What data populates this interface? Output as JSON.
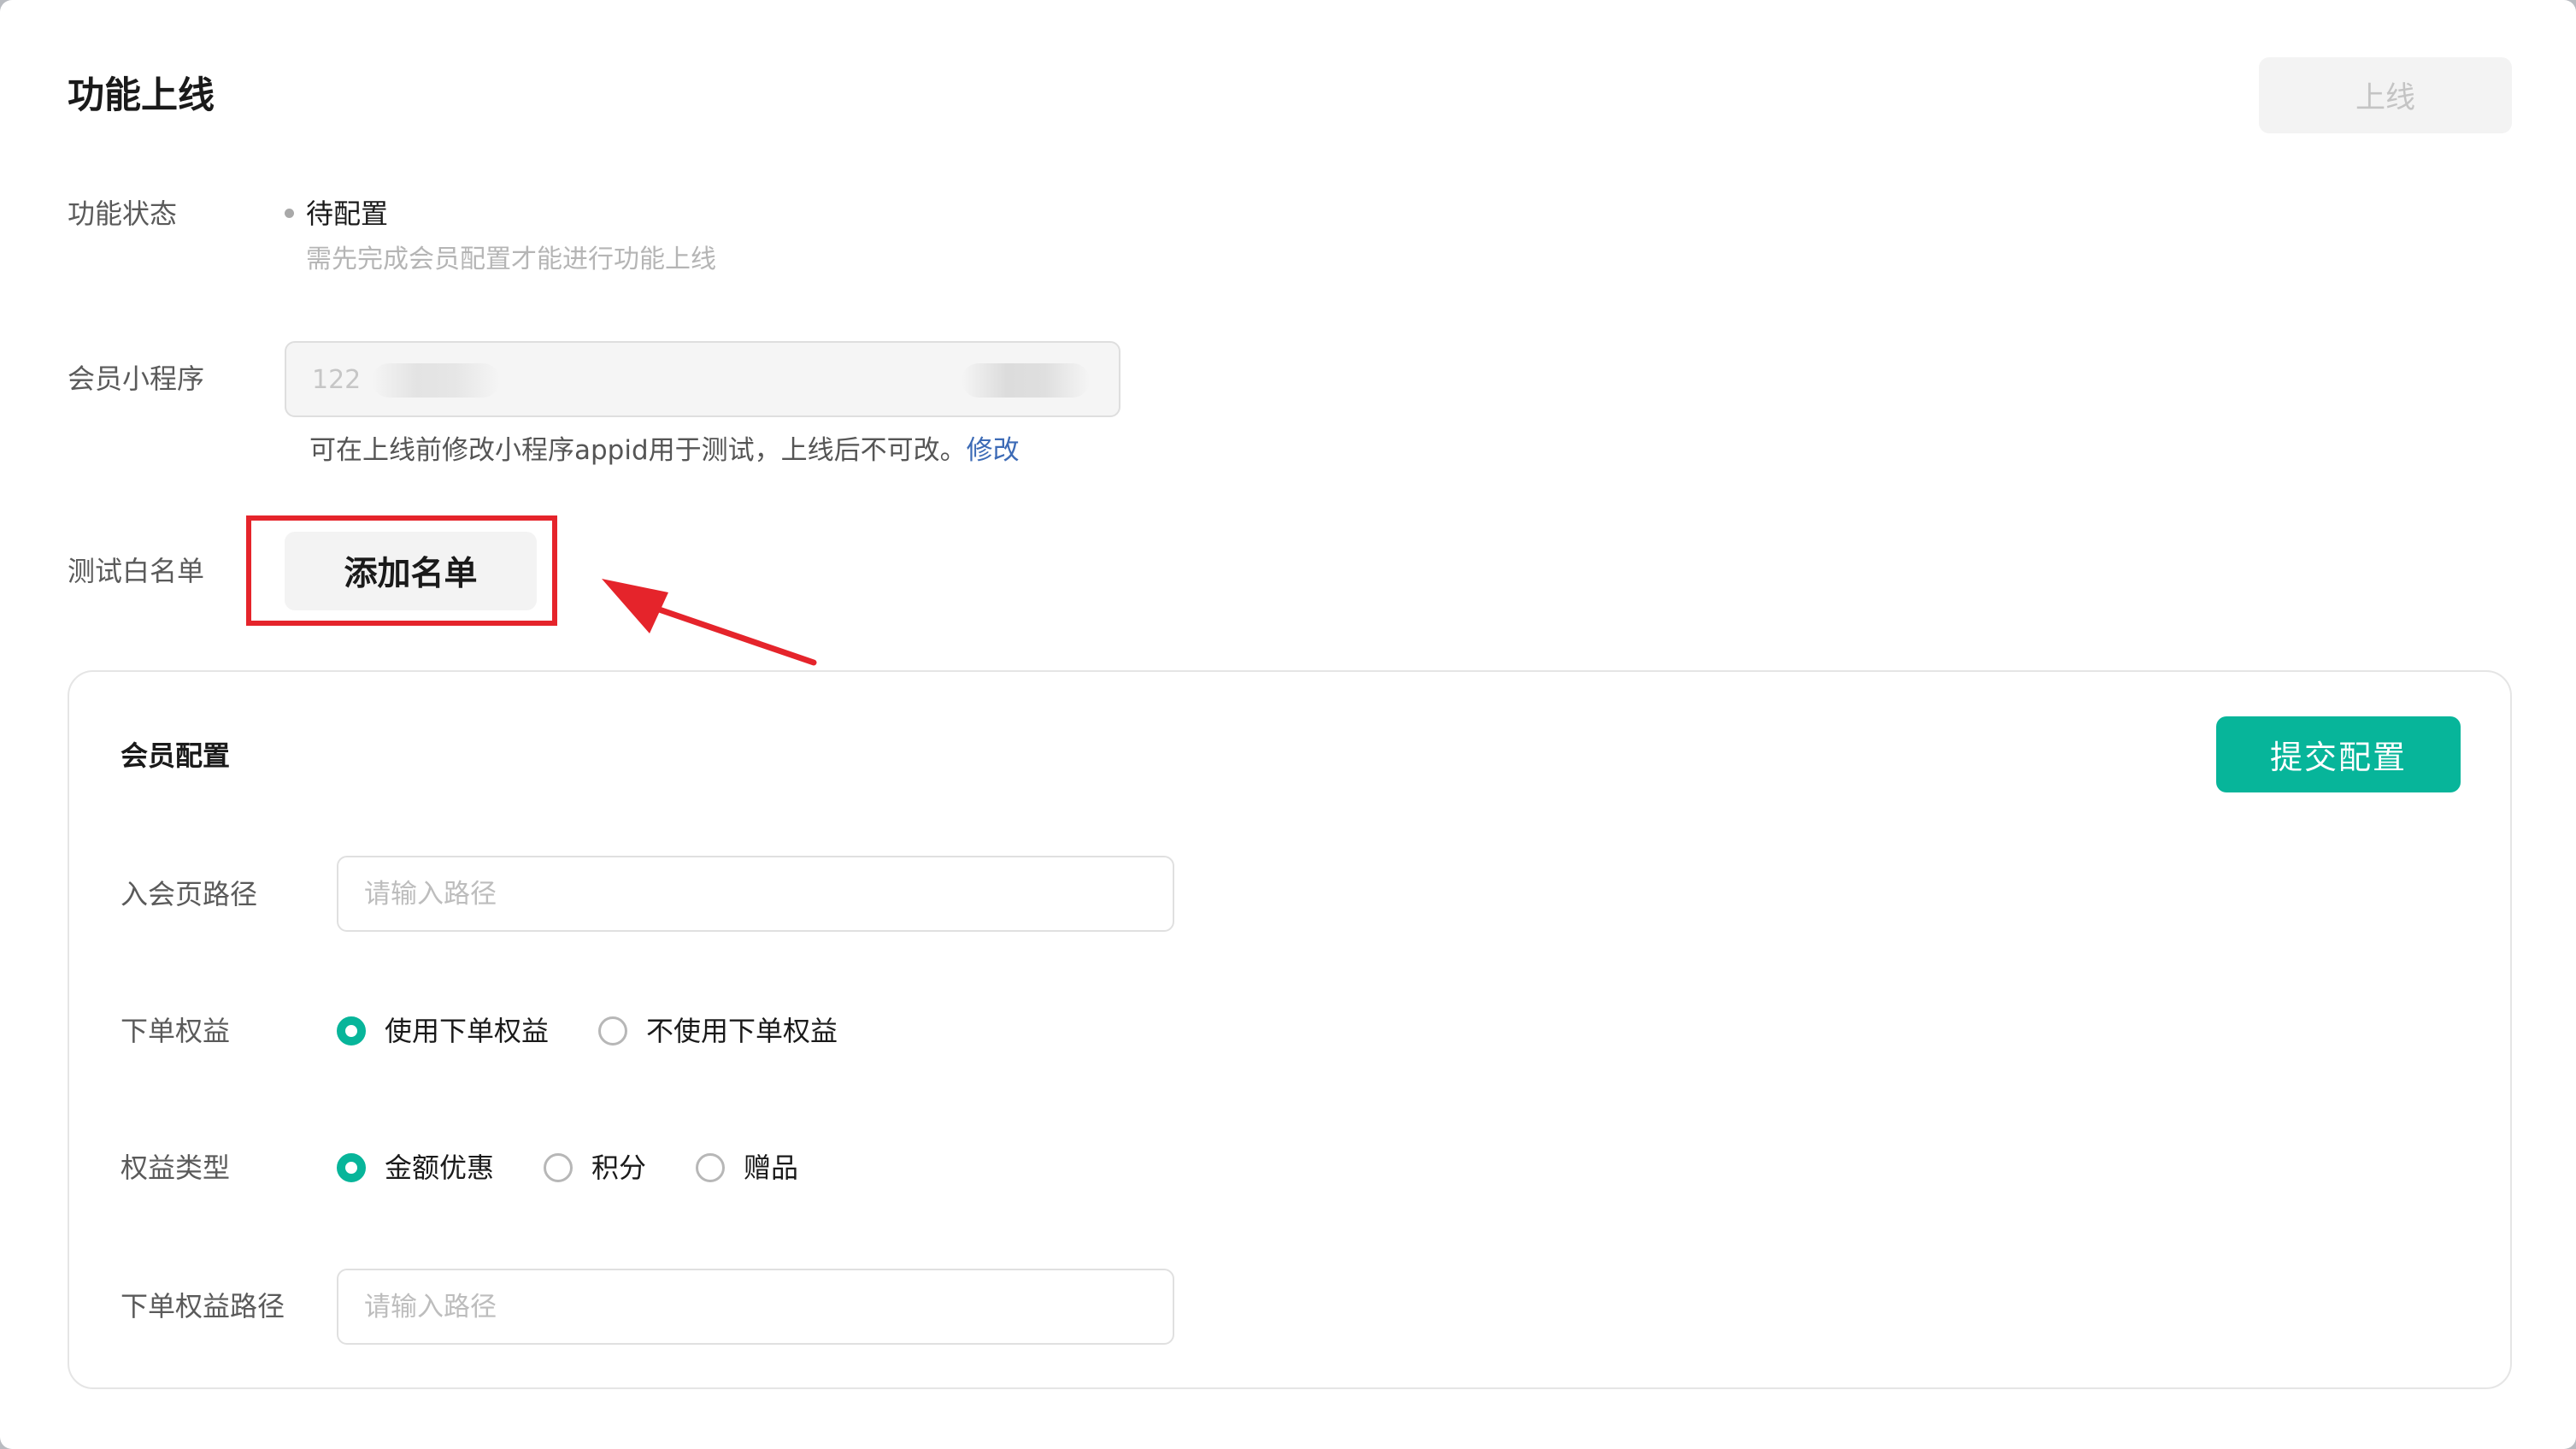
{
  "header": {
    "title": "功能上线",
    "online_button": "上线"
  },
  "status": {
    "label": "功能状态",
    "value": "待配置",
    "hint": "需先完成会员配置才能进行功能上线"
  },
  "mini_program": {
    "label": "会员小程序",
    "appid_value": "122",
    "hint": "可在上线前修改小程序appid用于测试，上线后不可改。",
    "modify_link": "修改"
  },
  "whitelist": {
    "label": "测试白名单",
    "add_button": "添加名单"
  },
  "member_config": {
    "title": "会员配置",
    "submit_button": "提交配置",
    "join_path": {
      "label": "入会页路径",
      "placeholder": "请输入路径",
      "value": ""
    },
    "order_benefit": {
      "label": "下单权益",
      "options": [
        "使用下单权益",
        "不使用下单权益"
      ],
      "selected": "使用下单权益"
    },
    "benefit_type": {
      "label": "权益类型",
      "options": [
        "金额优惠",
        "积分",
        "赠品"
      ],
      "selected": "金额优惠"
    },
    "order_benefit_path": {
      "label": "下单权益路径",
      "placeholder": "请输入路径",
      "value": ""
    }
  },
  "colors": {
    "primary": "#07b59a",
    "link": "#3d6bb6",
    "highlight": "#e5242b"
  },
  "icons": {
    "status_dot": "status-dot-icon",
    "annotation_arrow": "annotation-arrow-icon"
  }
}
